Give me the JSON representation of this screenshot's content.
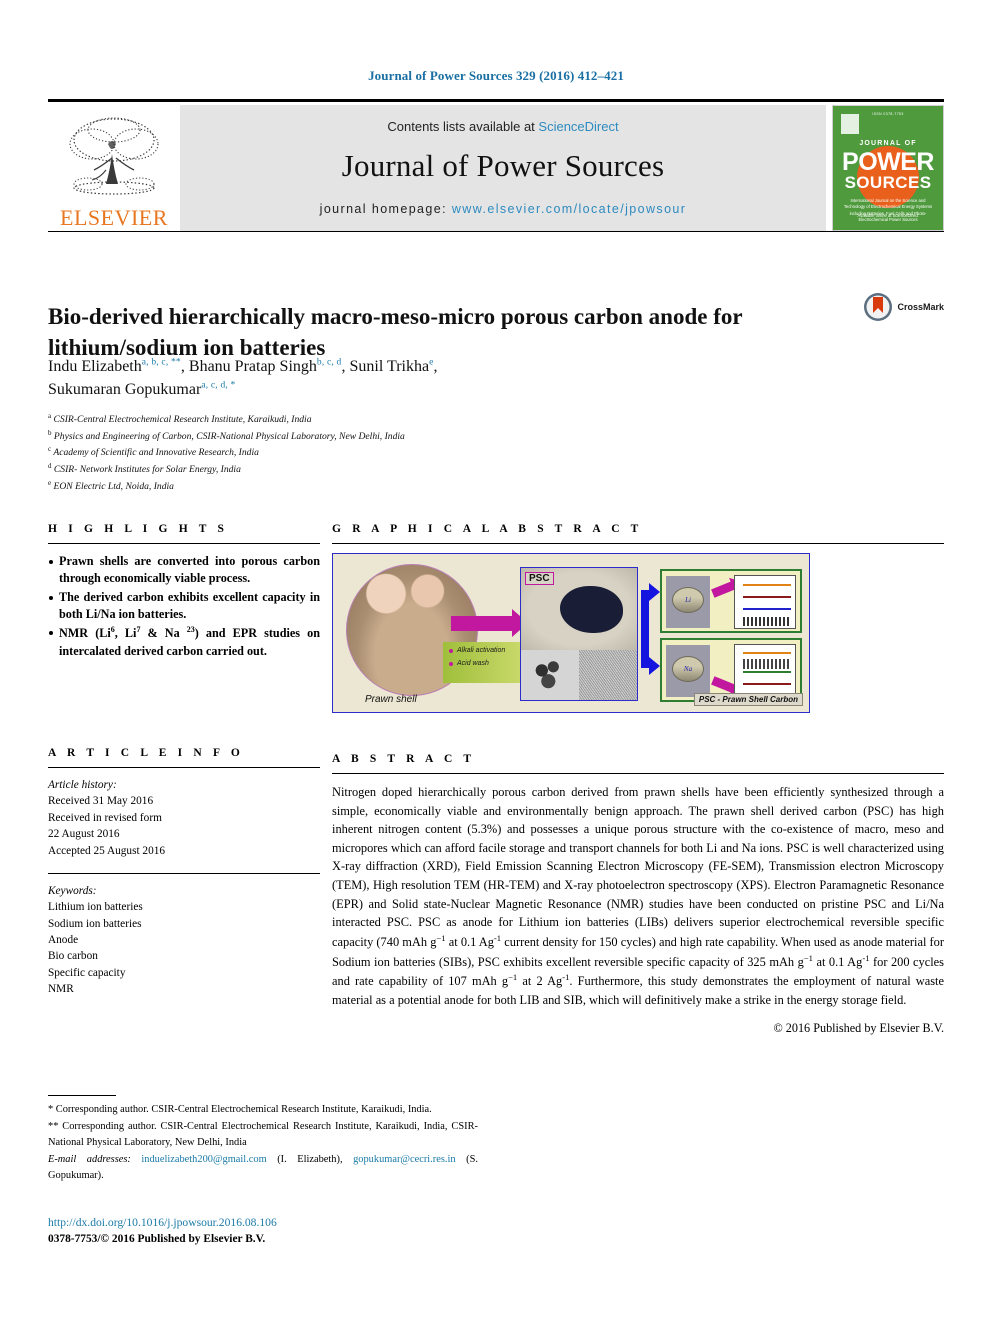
{
  "running_head": "Journal of Power Sources 329 (2016) 412–421",
  "masthead": {
    "contents_prefix": "Contents lists available at ",
    "sciencedirect": "ScienceDirect",
    "journal_title": "Journal of Power Sources",
    "homepage_prefix": "journal homepage: ",
    "homepage_url": "www.elsevier.com/locate/jpowsour",
    "publisher_wordmark": "ELSEVIER",
    "cover": {
      "top_text": "ISSN 0378-7753",
      "journal_of": "JOURNAL OF",
      "power": "POWER",
      "sources": "SOURCES",
      "blurb": "International Journal on the Science and Technology of Electrochemical Energy Systems including Batteries, Fuel Cells and Photo-Electrochemical Power Sources",
      "foot": "Available online at\nScienceDirect"
    }
  },
  "article": {
    "title": "Bio-derived hierarchically macro-meso-micro porous carbon anode for lithium/sodium ion batteries",
    "crossmark_label": "CrossMark",
    "authors": [
      {
        "name": "Indu Elizabeth",
        "marks": "a, b, c, **",
        "sep": ", "
      },
      {
        "name": "Bhanu Pratap Singh",
        "marks": "b, c, d",
        "sep": ", "
      },
      {
        "name": "Sunil Trikha",
        "marks": "e",
        "sep": ", "
      },
      {
        "name": "Sukumaran Gopukumar",
        "marks": "a, c, d, *",
        "sep": ""
      }
    ],
    "affiliations": [
      {
        "mark": "a",
        "text": "CSIR-Central Electrochemical Research Institute, Karaikudi, India"
      },
      {
        "mark": "b",
        "text": "Physics and Engineering of Carbon, CSIR-National Physical Laboratory, New Delhi, India"
      },
      {
        "mark": "c",
        "text": "Academy of Scientific and Innovative Research, India"
      },
      {
        "mark": "d",
        "text": "CSIR- Network Institutes for Solar Energy, India"
      },
      {
        "mark": "e",
        "text": "EON Electric Ltd, Noida, India"
      }
    ]
  },
  "highlights": {
    "heading": "H I G H L I G H T S",
    "items": [
      "Prawn shells are converted into porous carbon through economically viable process.",
      "The derived carbon exhibits excellent capacity in both Li/Na ion batteries.",
      "NMR (Li<sup>6</sup>, Li<sup>7</sup> &amp; Na <sup>23</sup>) and EPR studies on intercalated derived carbon carried out."
    ]
  },
  "graphical_abstract": {
    "heading": "G R A P H I C A L   A B S T R A C T",
    "labels": {
      "prawn_shell": "Prawn shell",
      "psc_tag": "PSC",
      "process_step_1": "Alkali activation",
      "process_step_2": "Acid wash",
      "coin_li": "Li",
      "coin_na": "Na",
      "footnote": "PSC - Prawn Shell Carbon"
    }
  },
  "article_info": {
    "heading": "A R T I C L E  I N F O",
    "history_label": "Article history:",
    "history": [
      "Received 31 May 2016",
      "Received in revised form",
      "22 August 2016",
      "Accepted 25 August 2016"
    ],
    "keywords_label": "Keywords:",
    "keywords": [
      "Lithium ion batteries",
      "Sodium ion batteries",
      "Anode",
      "Bio carbon",
      "Specific capacity",
      "NMR"
    ]
  },
  "abstract": {
    "heading": "A B S T R A C T",
    "text": "Nitrogen doped hierarchically porous carbon derived from prawn shells have been efficiently synthesized through a simple, economically viable and environmentally benign approach. The prawn shell derived carbon (PSC) has high inherent nitrogen content (5.3%) and possesses a unique porous structure with the co-existence of macro, meso and micropores which can afford facile storage and transport channels for both Li and Na ions. PSC is well characterized using X-ray diffraction (XRD), Field Emission Scanning Electron Microscopy (FE-SEM), Transmission electron Microscopy (TEM), High resolution TEM (HR-TEM) and X-ray photoelectron spectroscopy (XPS). Electron Paramagnetic Resonance (EPR) and Solid state-Nuclear Magnetic Resonance (NMR) studies have been conducted on pristine PSC and Li/Na interacted PSC. PSC as anode for Lithium ion batteries (LIBs) delivers superior electrochemical reversible specific capacity (740 mAh g<sup>&minus;1</sup> at 0.1 Ag<sup>-1</sup> current density for 150 cycles) and high rate capability. When used as anode material for Sodium ion batteries (SIBs), PSC exhibits excellent reversible specific capacity of 325 mAh g<sup>&minus;1</sup> at 0.1 Ag<sup>-1</sup> for 200 cycles and rate capability of 107 mAh g<sup>&minus;1</sup> at 2 Ag<sup>-1</sup>. Furthermore, this study demonstrates the employment of natural waste material as a potential anode for both LIB and SIB, which will definitively make a strike in the energy storage field.",
    "copyright": "© 2016 Published by Elsevier B.V."
  },
  "footnotes": {
    "corresponding_1": "* Corresponding author. CSIR-Central Electrochemical Research Institute, Karaikudi, India.",
    "corresponding_2": "** Corresponding author. CSIR-Central Electrochemical Research Institute, Karaikudi, India, CSIR-National Physical Laboratory, New Delhi, India",
    "email_label": "E-mail addresses:",
    "email_1": "induelizabeth200@gmail.com",
    "email_1_owner": "(I. Elizabeth),",
    "email_2": "gopukumar@cecri.res.in",
    "email_2_owner": "(S. Gopukumar).",
    "doi": "http://dx.doi.org/10.1016/j.jpowsour.2016.08.106",
    "issn": "0378-7753/© 2016 Published by Elsevier B.V."
  }
}
